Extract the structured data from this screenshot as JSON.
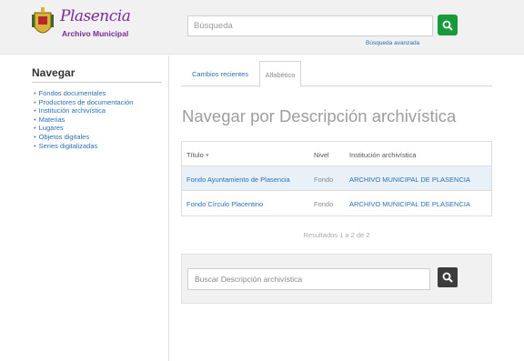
{
  "header": {
    "logo_script": "Plasencia",
    "logo_sub": "Archivo Municipal",
    "search_placeholder": "Búsqueda",
    "advanced_link": "Búsqueda avanzada"
  },
  "sidebar": {
    "title": "Navegar",
    "items": [
      {
        "label": "Fondos documentales"
      },
      {
        "label": "Productores de documentación"
      },
      {
        "label": "Institución archivística"
      },
      {
        "label": "Materias"
      },
      {
        "label": "Lugares"
      },
      {
        "label": "Objetos digitales"
      },
      {
        "label": "Series digitalizadas"
      }
    ]
  },
  "main": {
    "tabs": [
      {
        "label": "Cambios recientes"
      },
      {
        "label": "Alfabético"
      }
    ],
    "title": "Navegar por Descripción archivística",
    "table": {
      "headers": [
        "Título",
        "Nivel",
        "Institución archivística"
      ],
      "rows": [
        [
          "Fondo Ayuntamiento de Plasencia",
          "Fondo",
          "ARCHIVO MUNICIPAL DE PLASENCIA"
        ],
        [
          "Fondo Círculo Placentino",
          "Fondo",
          "ARCHIVO MUNICIPAL DE PLASENCIA"
        ]
      ]
    },
    "paging": "Resultados 1 a 2 de 2",
    "sub_search_placeholder": "Buscar Descripción archivística"
  },
  "colors": {
    "accent_green": "#169a3a",
    "link_blue": "#2a6fb3",
    "logo_purple": "#7a2a9a"
  }
}
